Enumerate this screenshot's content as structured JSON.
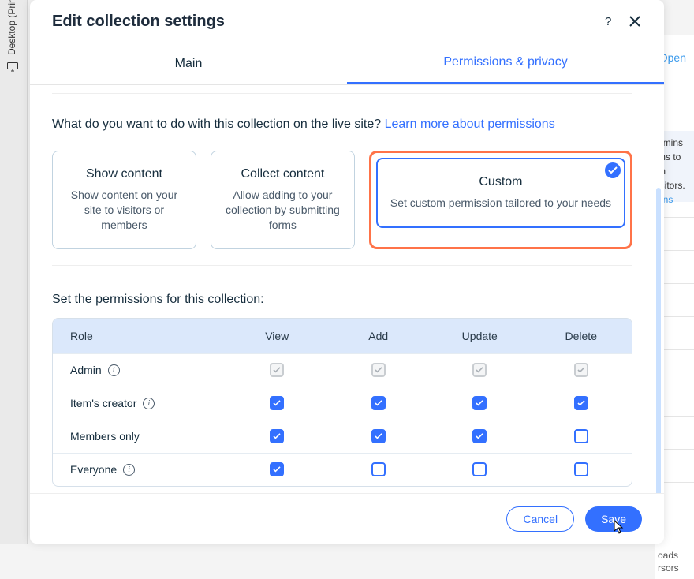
{
  "bg": {
    "left_label": "Desktop (Prima",
    "right_open": "Open",
    "right_panel": {
      "l1": "dmins",
      "l2": "ms to th",
      "l3": "isitors.",
      "link": "ons"
    },
    "right_foot": {
      "l1": "oads",
      "l2": "rsors"
    }
  },
  "modal": {
    "title": "Edit collection settings",
    "tabs": {
      "main": "Main",
      "perm": "Permissions & privacy"
    },
    "question": "What do you want to do with this collection on the live site?",
    "learn_link": "Learn more about permissions",
    "cards": {
      "show": {
        "title": "Show content",
        "desc": "Show content on your site to visitors or members"
      },
      "collect": {
        "title": "Collect content",
        "desc": "Allow adding to your collection by submitting forms"
      },
      "custom": {
        "title": "Custom",
        "desc": "Set custom permission tailored to your needs"
      }
    },
    "table": {
      "heading": "Set the permissions for this collection:",
      "cols": {
        "role": "Role",
        "view": "View",
        "add": "Add",
        "update": "Update",
        "delete": "Delete"
      },
      "rows": {
        "admin": {
          "label": "Admin",
          "info": true,
          "view": "locked",
          "add": "locked",
          "update": "locked",
          "delete": "locked"
        },
        "creator": {
          "label": "Item's creator",
          "info": true,
          "view": "on",
          "add": "on",
          "update": "on",
          "delete": "on"
        },
        "members": {
          "label": "Members only",
          "info": false,
          "view": "on",
          "add": "on",
          "update": "on",
          "delete": "off"
        },
        "everyone": {
          "label": "Everyone",
          "info": true,
          "view": "on",
          "add": "off",
          "update": "off",
          "delete": "off"
        }
      }
    },
    "footer": {
      "cancel": "Cancel",
      "save": "Save"
    }
  }
}
